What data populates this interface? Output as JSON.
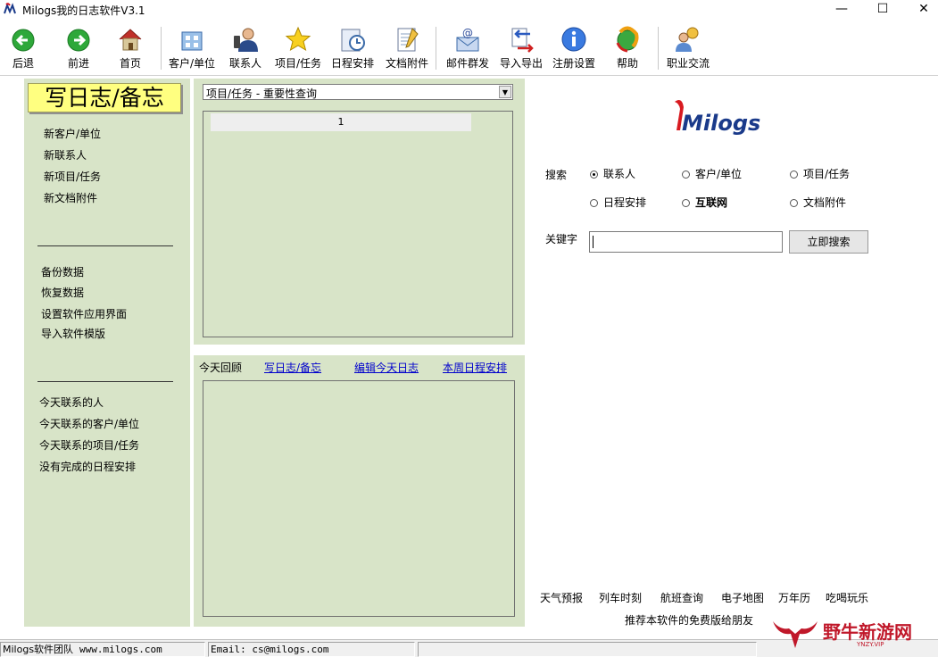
{
  "window": {
    "title": "Milogs我的日志软件V3.1",
    "minimize": "—",
    "maximize": "☐",
    "close": "✕"
  },
  "toolbar": [
    {
      "label": "后退",
      "icon": "back-arrow-icon"
    },
    {
      "label": "前进",
      "icon": "forward-arrow-icon"
    },
    {
      "label": "首页",
      "icon": "home-icon"
    },
    {
      "label": "客户/单位",
      "icon": "customer-icon"
    },
    {
      "label": "联系人",
      "icon": "contact-icon"
    },
    {
      "label": "项目/任务",
      "icon": "star-icon"
    },
    {
      "label": "日程安排",
      "icon": "schedule-icon"
    },
    {
      "label": "文档附件",
      "icon": "document-icon"
    },
    {
      "label": "邮件群发",
      "icon": "mail-icon"
    },
    {
      "label": "导入导出",
      "icon": "import-export-icon"
    },
    {
      "label": "注册设置",
      "icon": "info-icon"
    },
    {
      "label": "帮助",
      "icon": "help-icon"
    },
    {
      "label": "职业交流",
      "icon": "community-icon"
    }
  ],
  "left": {
    "write_button": "写日志/备忘",
    "new_items": [
      "新客户/单位",
      "新联系人",
      "新项目/任务",
      "新文档附件"
    ],
    "data_items": [
      "备份数据",
      "恢复数据",
      "设置软件应用界面",
      "导入软件模版"
    ],
    "today_items": [
      "今天联系的人",
      "今天联系的客户/单位",
      "今天联系的项目/任务",
      "没有完成的日程安排"
    ]
  },
  "query": {
    "selected": "项目/任务 - 重要性查询",
    "first_row": "1"
  },
  "review": {
    "label": "今天回顾",
    "links": [
      "写日志/备忘",
      "编辑今天日志",
      "本周日程安排"
    ]
  },
  "logo_text": "Milogs",
  "search": {
    "label": "搜索",
    "options": [
      {
        "label": "联系人",
        "checked": true
      },
      {
        "label": "客户/单位",
        "checked": false
      },
      {
        "label": "项目/任务",
        "checked": false
      },
      {
        "label": "日程安排",
        "checked": false
      },
      {
        "label": "互联网",
        "checked": false
      },
      {
        "label": "文档附件",
        "checked": false
      }
    ],
    "keyword_label": "关键字",
    "keyword_value": "",
    "button": "立即搜索"
  },
  "quick_links": [
    "天气预报",
    "列车时刻",
    "航班查询",
    "电子地图",
    "万年历",
    "吃喝玩乐"
  ],
  "recommend": "推荐本软件的免费版给朋友",
  "status": {
    "team": "Milogs软件团队",
    "website": "www.milogs.com",
    "email": "Email:  cs@milogs.com"
  },
  "watermark": {
    "text": "野牛新游网",
    "sub": "YNZY.VIP"
  }
}
